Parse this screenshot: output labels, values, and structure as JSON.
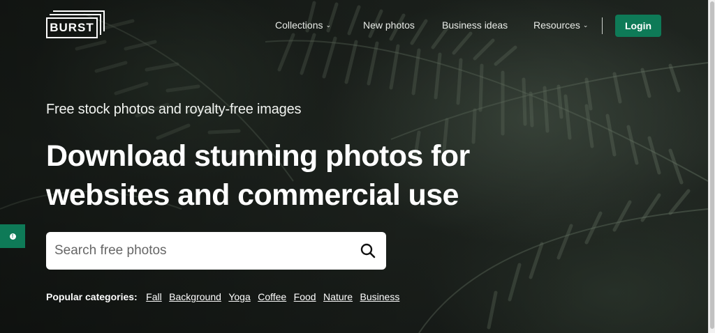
{
  "brand": {
    "logo_text": "BURST"
  },
  "nav": {
    "items": [
      {
        "label": "Collections",
        "caret": true
      },
      {
        "label": "New photos",
        "caret": false
      },
      {
        "label": "Business ideas",
        "caret": false
      },
      {
        "label": "Resources",
        "caret": true
      }
    ],
    "login_label": "Login",
    "caret_glyph": "⌄"
  },
  "hero": {
    "subtitle": "Free stock photos and royalty-free images",
    "headline_line1": "Download stunning photos for",
    "headline_line2": "websites and commercial use"
  },
  "search": {
    "placeholder": "Search free photos",
    "value": ""
  },
  "categories": {
    "label": "Popular categories:",
    "items": [
      "Fall",
      "Background",
      "Yoga",
      "Coffee",
      "Food",
      "Nature",
      "Business"
    ]
  },
  "colors": {
    "accent": "#0e7a57",
    "text": "#ffffff",
    "background": "#1f2520"
  }
}
